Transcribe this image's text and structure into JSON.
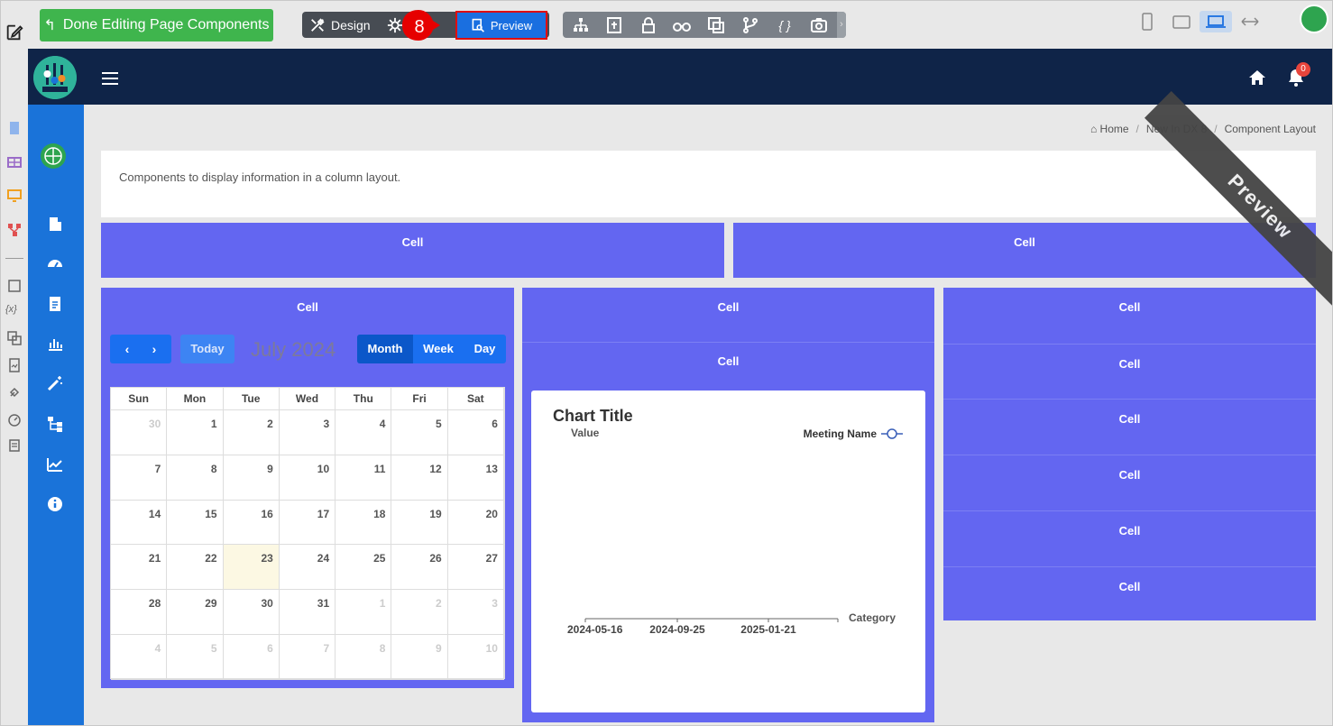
{
  "toolbar": {
    "done_label": "Done Editing Page Components",
    "design_label": "Design",
    "step_number": "8",
    "preview_label": "Preview"
  },
  "header": {
    "notification_count": "0"
  },
  "breadcrumb": {
    "home": "Home",
    "parent": "New In DX 8",
    "current": "Component Layout"
  },
  "description": "Components to display information in a column layout.",
  "cells": {
    "top_left": "Cell",
    "top_right": "Cell",
    "col1_header": "Cell",
    "col2_header1": "Cell",
    "col2_header2": "Cell",
    "col3": [
      "Cell",
      "Cell",
      "Cell",
      "Cell",
      "Cell",
      "Cell"
    ]
  },
  "calendar": {
    "today_label": "Today",
    "title": "July 2024",
    "views": [
      "Month",
      "Week",
      "Day"
    ],
    "active_view": "Month",
    "weekdays": [
      "Sun",
      "Mon",
      "Tue",
      "Wed",
      "Thu",
      "Fri",
      "Sat"
    ],
    "weeks": [
      [
        "30",
        "1",
        "2",
        "3",
        "4",
        "5",
        "6"
      ],
      [
        "7",
        "8",
        "9",
        "10",
        "11",
        "12",
        "13"
      ],
      [
        "14",
        "15",
        "16",
        "17",
        "18",
        "19",
        "20"
      ],
      [
        "21",
        "22",
        "23",
        "24",
        "25",
        "26",
        "27"
      ],
      [
        "28",
        "29",
        "30",
        "31",
        "1",
        "2",
        "3"
      ],
      [
        "4",
        "5",
        "6",
        "7",
        "8",
        "9",
        "10"
      ]
    ],
    "today_date": "23"
  },
  "chart_data": {
    "type": "line",
    "title": "Chart Title",
    "xlabel": "Category",
    "ylabel": "Value",
    "series": [
      {
        "name": "Meeting Name",
        "values": []
      }
    ],
    "x_ticks": [
      "2024-05-16",
      "2024-09-25",
      "2025-01-21"
    ],
    "legend": "top-right",
    "grid": false
  },
  "ribbon_label": "Preview",
  "colors": {
    "accent": "#6366f1",
    "header": "#0f2448",
    "sidebar": "#1a73d9",
    "done_button": "#3fb54d",
    "preview_button": "#1a6fe0"
  }
}
